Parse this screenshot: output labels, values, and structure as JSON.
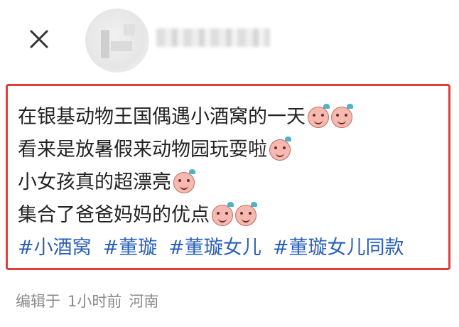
{
  "post": {
    "lines": [
      "在银基动物王国偶遇小酒窝的一天",
      "看来是放暑假来动物园玩耍啦",
      "小女孩真的超漂亮",
      "集合了爸爸妈妈的优点"
    ],
    "hashtags": [
      "#小酒窝",
      "#董璇",
      "#董璇女儿",
      "#董璇女儿同款"
    ]
  },
  "meta": {
    "edited": "编辑于",
    "time": "1小时前",
    "location": "河南"
  },
  "colors": {
    "highlight_border": "#e03c3c",
    "hashtag": "#2a5fb8",
    "meta_text": "#8a8a8a"
  },
  "icons": [
    "close-icon",
    "avatar",
    "emoji-sticker"
  ]
}
